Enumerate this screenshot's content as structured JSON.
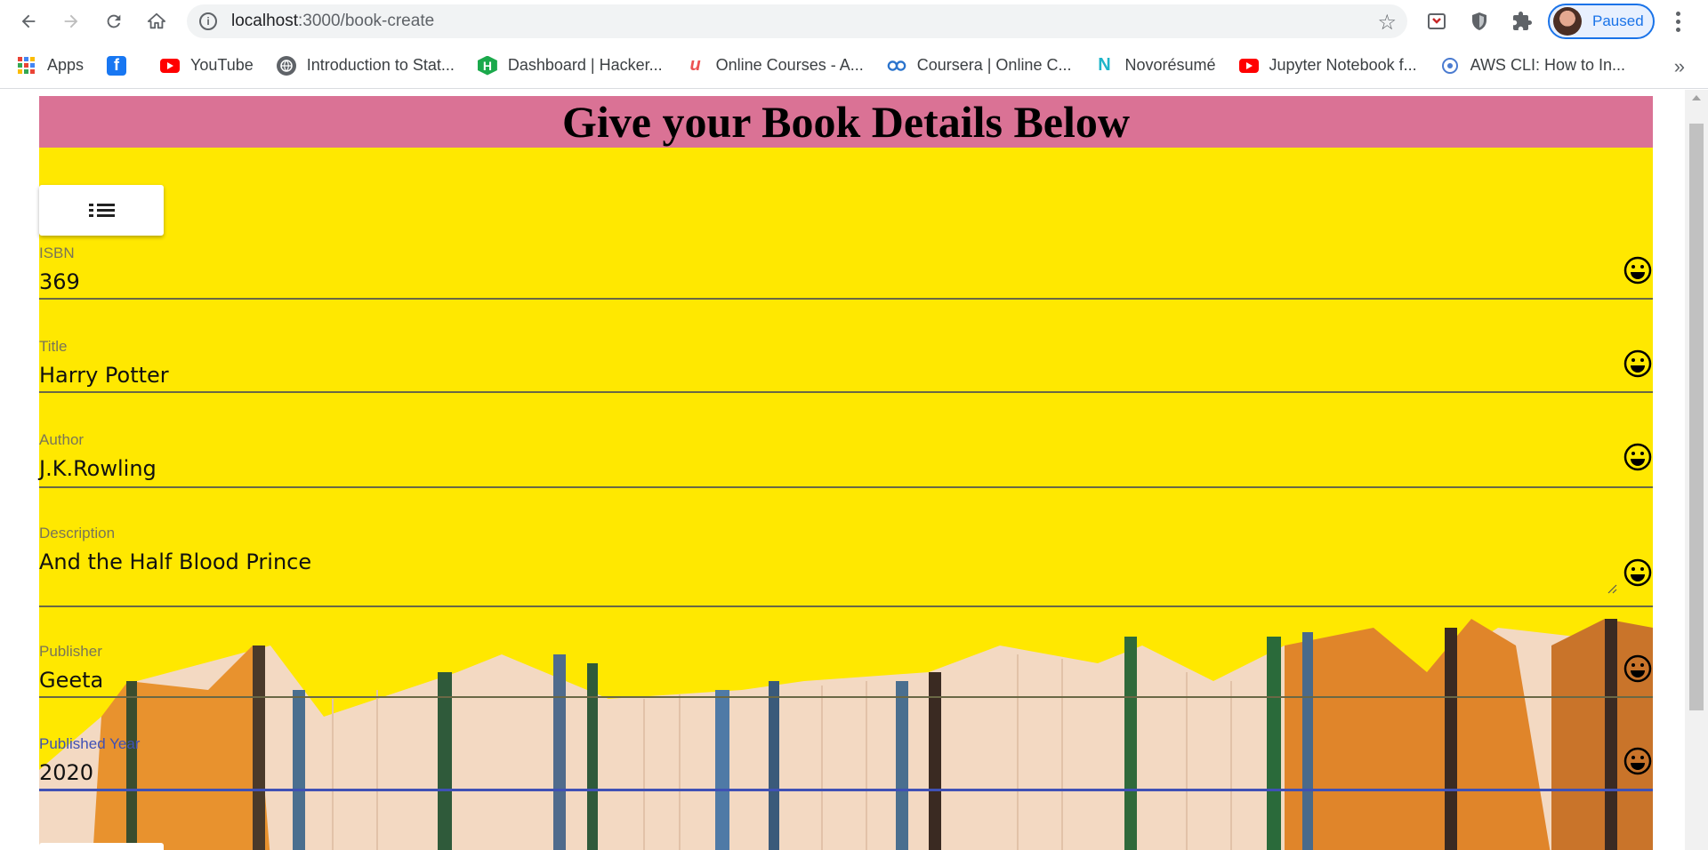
{
  "browser": {
    "url_host": "localhost",
    "url_path": ":3000/book-create",
    "profile_label": "Paused"
  },
  "bookmarks": [
    {
      "label": "Apps",
      "icon": "apps-grid-icon"
    },
    {
      "label": "",
      "icon": "facebook-icon",
      "color": "#1877f2"
    },
    {
      "label": "YouTube",
      "icon": "youtube-icon",
      "color": "#ff0000"
    },
    {
      "label": "Introduction to Stat...",
      "icon": "globe-icon",
      "color": "#5f6368"
    },
    {
      "label": "Dashboard | Hacker...",
      "icon": "hackerrank-icon",
      "color": "#1ba94c"
    },
    {
      "label": "Online Courses - A...",
      "icon": "udemy-icon",
      "color": "#ec5252"
    },
    {
      "label": "Coursera | Online C...",
      "icon": "coursera-icon",
      "color": "#2a73cc"
    },
    {
      "label": "Novorésumé",
      "icon": "novoresume-icon",
      "color": "#1fb5c9"
    },
    {
      "label": "Jupyter Notebook f...",
      "icon": "youtube-icon",
      "color": "#ff0000"
    },
    {
      "label": "AWS CLI: How to In...",
      "icon": "aws-icon",
      "color": "#4a7bd0"
    }
  ],
  "page": {
    "heading": "Give your Book Details Below",
    "fields": [
      {
        "label": "ISBN",
        "value": "369"
      },
      {
        "label": "Title",
        "value": "Harry Potter"
      },
      {
        "label": "Author",
        "value": "J.K.Rowling"
      },
      {
        "label": "Description",
        "value": "And the Half Blood Prince"
      },
      {
        "label": "Publisher",
        "value": "Geeta"
      },
      {
        "label": "Published Year",
        "value": "2020"
      }
    ]
  },
  "colors": {
    "header": "#da7295",
    "background": "#ffe800",
    "focus": "#3f51b5"
  }
}
